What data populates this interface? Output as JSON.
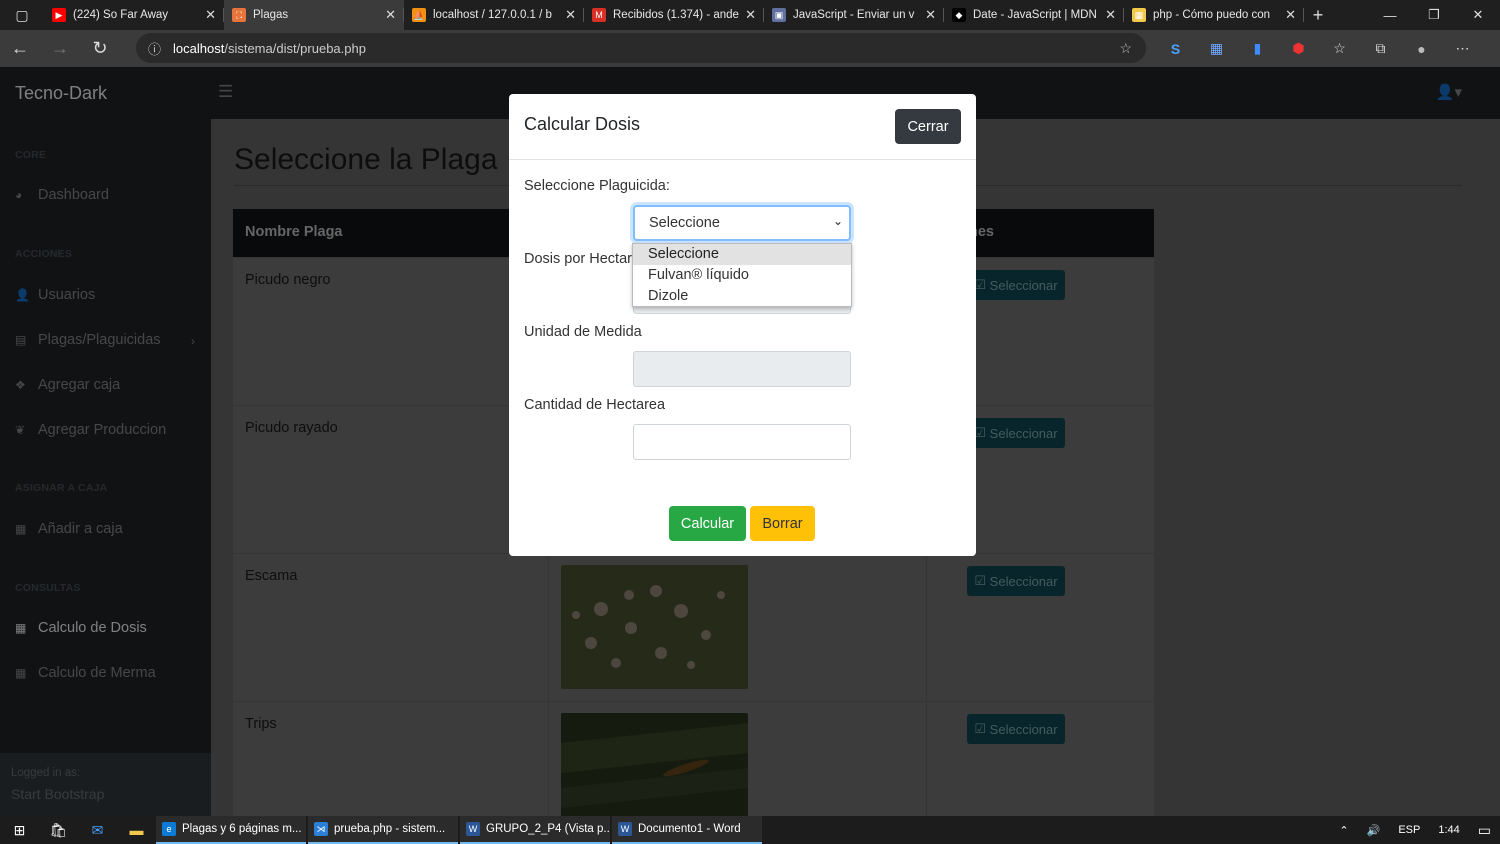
{
  "browser": {
    "tabs": [
      {
        "title": "(224) So Far Away",
        "color": "#ff0000",
        "glyph": "▶"
      },
      {
        "title": "Plagas",
        "color": "#e8743b",
        "glyph": "⛶"
      },
      {
        "title": "localhost / 127.0.0.1 / b",
        "color": "#f29111",
        "glyph": "⛵"
      },
      {
        "title": "Recibidos (1.374) - ande",
        "color": "#d93025",
        "glyph": "M"
      },
      {
        "title": "JavaScript - Enviar un v",
        "color": "#5f6f9f",
        "glyph": "▣"
      },
      {
        "title": "Date - JavaScript | MDN",
        "color": "#000000",
        "glyph": "◆"
      },
      {
        "title": "php - Cómo puedo con",
        "color": "#f2c94c",
        "glyph": "▦"
      }
    ],
    "url_host": "localhost",
    "url_path": "/sistema/dist/prueba.php"
  },
  "app": {
    "brand": "Tecno-Dark",
    "sidebar": {
      "core_heading": "CORE",
      "dashboard": "Dashboard",
      "acciones_heading": "ACCIONES",
      "usuarios": "Usuarios",
      "plagas": "Plagas/Plaguicidas",
      "agregar_caja": "Agregar caja",
      "agregar_produccion": "Agregar Produccion",
      "asignar_heading": "ASIGNAR A CAJA",
      "anadir_caja": "Añadir a caja",
      "consultas_heading": "CONSULTAS",
      "calculo_dosis": "Calculo de Dosis",
      "calculo_merma": "Calculo de Merma",
      "logged_in": "Logged in as:",
      "user": "Start Bootstrap"
    },
    "page_title": "Seleccione la Plaga",
    "table": {
      "headers": [
        "Nombre Plaga",
        "nes"
      ],
      "rows": [
        {
          "name": "Picudo negro",
          "action": "Seleccionar"
        },
        {
          "name": "Picudo rayado",
          "action": "Seleccionar"
        },
        {
          "name": "Escama",
          "action": "Seleccionar"
        },
        {
          "name": "Trips",
          "action": "Seleccionar"
        }
      ]
    }
  },
  "modal": {
    "title": "Calcular Dosis",
    "close": "Cerrar",
    "plaguicida_label": "Seleccione Plaguicida:",
    "selected": "Seleccione",
    "options": [
      "Seleccione",
      "Fulvan® líquido",
      "Dizole"
    ],
    "dosis_label": "Dosis por Hectar",
    "unidad_label": "Unidad de Medida",
    "cantidad_label": "Cantidad de Hectarea",
    "calcular": "Calcular",
    "borrar": "Borrar"
  },
  "taskbar": {
    "apps": [
      {
        "title": "Plagas y 6 páginas m...",
        "color": "#0c7bd6",
        "glyph": "e"
      },
      {
        "title": "prueba.php - sistem...",
        "color": "#2b7fd6",
        "glyph": "⋊"
      },
      {
        "title": "GRUPO_2_P4 (Vista p...",
        "color": "#2b5797",
        "glyph": "W"
      },
      {
        "title": "Documento1 - Word",
        "color": "#2b5797",
        "glyph": "W"
      }
    ],
    "lang": "ESP",
    "time": "1:44"
  }
}
